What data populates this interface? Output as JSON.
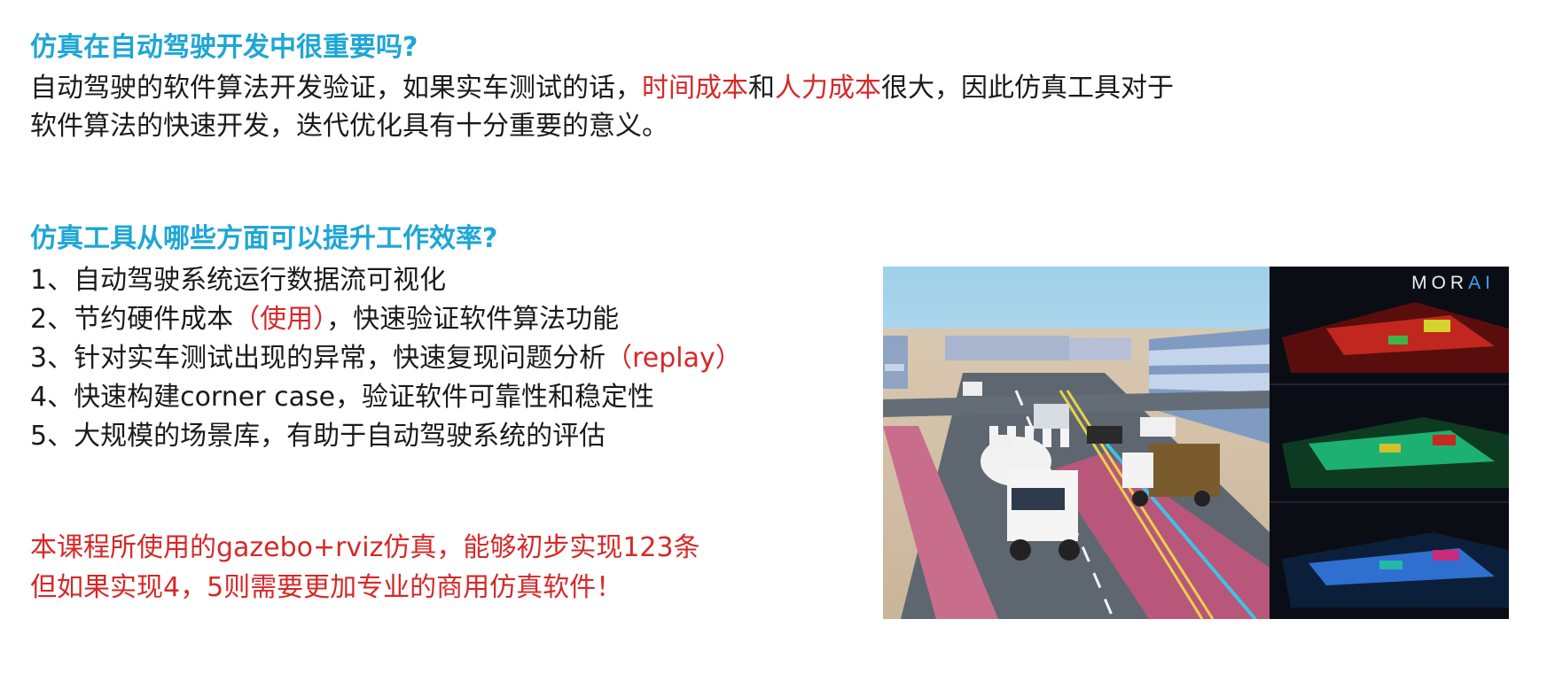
{
  "section1": {
    "heading": "仿真在自动驾驶开发中很重要吗?",
    "line1": {
      "pre": "自动驾驶的软件算法开发验证，如果实车测试的话，",
      "hl1": "时间成本",
      "mid": "和",
      "hl2": "人力成本",
      "post": "很大，因此仿真工具对于"
    },
    "line2": "软件算法的快速开发，迭代优化具有十分重要的意义。"
  },
  "section2": {
    "heading": "仿真工具从哪些方面可以提升工作效率?",
    "items": [
      {
        "text": "1、自动驾驶系统运行数据流可视化",
        "hl": "",
        "tail": ""
      },
      {
        "text": "2、节约硬件成本",
        "hl": "（使用）",
        "tail": "，快速验证软件算法功能"
      },
      {
        "text": "3、针对实车测试出现的异常，快速复现问题分析",
        "hl": "（replay）",
        "tail": ""
      },
      {
        "text": "4、快速构建corner case，验证软件可靠性和稳定性",
        "hl": "",
        "tail": ""
      },
      {
        "text": "5、大规模的场景库，有助于自动驾驶系统的评估",
        "hl": "",
        "tail": ""
      }
    ]
  },
  "note": {
    "line1": "本课程所使用的gazebo+rviz仿真，能够初步实现123条",
    "line2": "但如果实现4，5则需要更加专业的商用仿真软件！"
  },
  "figure": {
    "logo_main": "MOR",
    "logo_accent": "AI"
  },
  "colors": {
    "heading": "#1ea6d6",
    "highlight": "#d62828",
    "text": "#1a1a1a",
    "logo_accent": "#3fa0ff"
  }
}
